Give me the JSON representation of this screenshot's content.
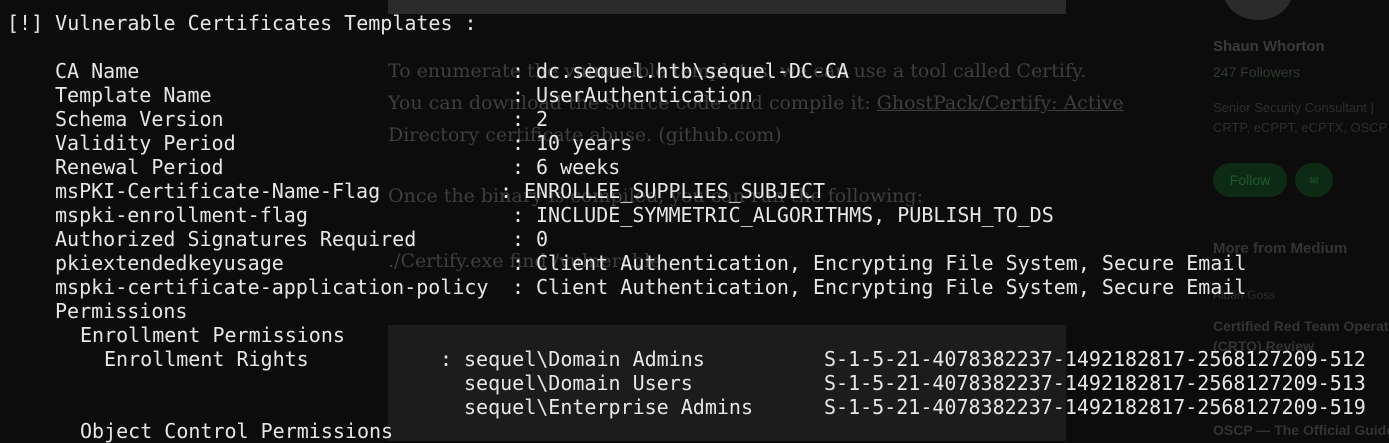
{
  "background": {
    "article": {
      "para1_line1": "To enumerate the vulnerable templates, we can use a tool called Certify.",
      "para1_line2_text": "You can download the source code and compile it: ",
      "para1_line2_link": "GhostPack/Certify: Active",
      "para1_line3_link": "Directory certificate abuse. (github.com)",
      "para2": "Once the binary is compiled, you can run the following:",
      "command": "./Certify.exe find /vulnerable"
    },
    "sidebar": {
      "author_name": "Shaun Whorton",
      "followers": "247 Followers",
      "bio_line1": "Senior Security Consultant |",
      "bio_line2": "CRTP, eCPPT, eCPTX, OSCP",
      "follow_label": "Follow",
      "more_from": "More from Medium",
      "story_author": "Aidan Goss",
      "story1_line1": "Certified Red Team Operator",
      "story1_line2": "(CRTO) Review",
      "story2_line1": "OSCP — The Official Guide"
    }
  },
  "terminal": {
    "heading": "[!] Vulnerable Certificates Templates :",
    "fields": [
      {
        "label": "CA Name",
        "value": "dc.sequel.htb\\sequel-DC-CA"
      },
      {
        "label": "Template Name",
        "value": "UserAuthentication"
      },
      {
        "label": "Schema Version",
        "value": "2"
      },
      {
        "label": "Validity Period",
        "value": "10 years"
      },
      {
        "label": "Renewal Period",
        "value": "6 weeks"
      },
      {
        "label": "msPKI-Certificate-Name-Flag",
        "value": "ENROLLEE_SUPPLIES_SUBJECT"
      },
      {
        "label": "mspki-enrollment-flag",
        "value": "INCLUDE_SYMMETRIC_ALGORITHMS, PUBLISH_TO_DS"
      },
      {
        "label": "Authorized Signatures Required",
        "value": "0"
      },
      {
        "label": "pkiextendedkeyusage",
        "value": "Client Authentication, Encrypting File System, Secure Email"
      },
      {
        "label": "mspki-certificate-application-policy",
        "value": "Client Authentication, Encrypting File System, Secure Email"
      }
    ],
    "permissions_label": "Permissions",
    "enrollment_permissions_label": "Enrollment Permissions",
    "enrollment_rights_label": "Enrollment Rights",
    "enrollment_rights": [
      {
        "principal": "sequel\\Domain Admins",
        "sid": "S-1-5-21-4078382237-1492182817-2568127209-512"
      },
      {
        "principal": "sequel\\Domain Users",
        "sid": "S-1-5-21-4078382237-1492182817-2568127209-513"
      },
      {
        "principal": "sequel\\Enterprise Admins",
        "sid": "S-1-5-21-4078382237-1492182817-2568127209-519"
      }
    ],
    "object_control_label": "Object Control Permissions"
  }
}
